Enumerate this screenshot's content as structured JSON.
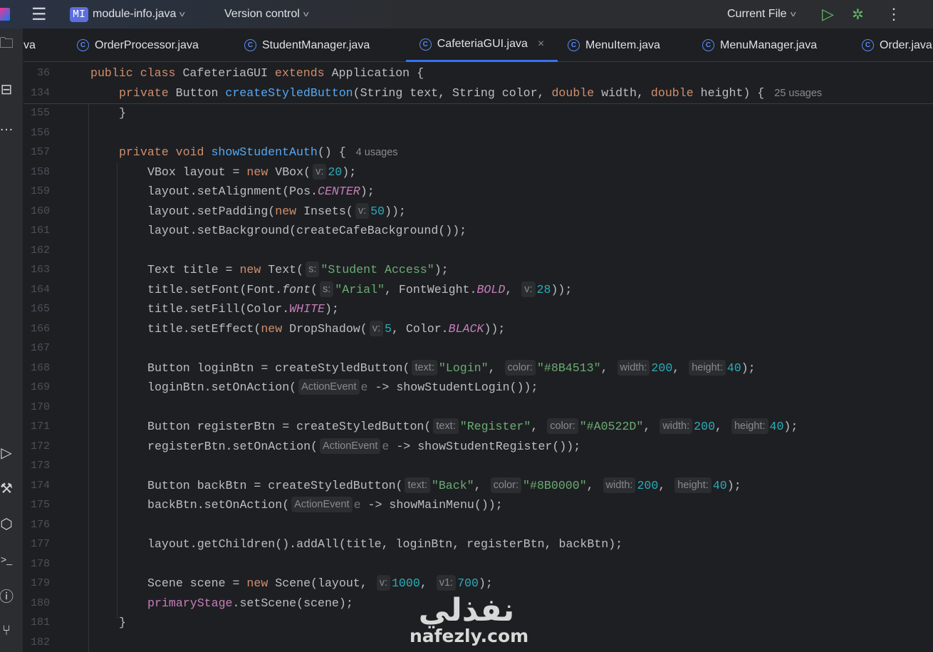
{
  "topbar": {
    "project_badge": "MI",
    "project_name": "module-info.java",
    "vcs": "Version control",
    "run_config": "Current File"
  },
  "tabs": [
    {
      "label": "va",
      "icon": false
    },
    {
      "label": "OrderProcessor.java",
      "icon": true
    },
    {
      "label": "StudentManager.java",
      "icon": true
    },
    {
      "label": "CafeteriaGUI.java",
      "icon": true,
      "active": true
    },
    {
      "label": "MenuItem.java",
      "icon": true
    },
    {
      "label": "MenuManager.java",
      "icon": true
    },
    {
      "label": "Order.java",
      "icon": true
    }
  ],
  "colors": {
    "keyword": "#cf8e6d",
    "function": "#56a8f5",
    "string": "#6aab73",
    "number": "#2aacb8",
    "constant": "#c77dbb",
    "accent": "#3574f0"
  },
  "code": [
    {
      "n": "36",
      "indent": 0,
      "t": [
        [
          "kw",
          "public class "
        ],
        [
          "p",
          "CafeteriaGUI "
        ],
        [
          "kw",
          "extends "
        ],
        [
          "p",
          "Application {"
        ]
      ]
    },
    {
      "n": "134",
      "indent": 1,
      "t": [
        [
          "kw",
          "private "
        ],
        [
          "p",
          "Button "
        ],
        [
          "fn",
          "createStyledButton"
        ],
        [
          "p",
          "(String text, String color, "
        ],
        [
          "kw",
          "double "
        ],
        [
          "p",
          "width, "
        ],
        [
          "kw",
          "double "
        ],
        [
          "p",
          "height) {"
        ],
        [
          "u",
          "25 usages"
        ]
      ]
    },
    {
      "n": "155",
      "indent": 1,
      "t": [
        [
          "p",
          "}"
        ]
      ]
    },
    {
      "n": "156",
      "indent": 0,
      "t": []
    },
    {
      "n": "157",
      "indent": 1,
      "t": [
        [
          "kw",
          "private void "
        ],
        [
          "fn",
          "showStudentAuth"
        ],
        [
          "p",
          "() {"
        ],
        [
          "u",
          "4 usages"
        ]
      ]
    },
    {
      "n": "158",
      "indent": 2,
      "t": [
        [
          "p",
          "VBox layout = "
        ],
        [
          "kw",
          "new "
        ],
        [
          "p",
          "VBox("
        ],
        [
          "h",
          "v:"
        ],
        [
          "num",
          "20"
        ],
        [
          "p",
          ");"
        ]
      ]
    },
    {
      "n": "159",
      "indent": 2,
      "t": [
        [
          "p",
          "layout.setAlignment(Pos."
        ],
        [
          "c",
          "CENTER"
        ],
        [
          "p",
          ");"
        ]
      ]
    },
    {
      "n": "160",
      "indent": 2,
      "t": [
        [
          "p",
          "layout.setPadding("
        ],
        [
          "kw",
          "new "
        ],
        [
          "p",
          "Insets("
        ],
        [
          "h",
          "v:"
        ],
        [
          "num",
          "50"
        ],
        [
          "p",
          "));"
        ]
      ]
    },
    {
      "n": "161",
      "indent": 2,
      "t": [
        [
          "p",
          "layout.setBackground(createCafeBackground());"
        ]
      ]
    },
    {
      "n": "162",
      "indent": 0,
      "t": []
    },
    {
      "n": "163",
      "indent": 2,
      "t": [
        [
          "p",
          "Text title = "
        ],
        [
          "kw",
          "new "
        ],
        [
          "p",
          "Text("
        ],
        [
          "h",
          "s:"
        ],
        [
          "str",
          "\"Student Access\""
        ],
        [
          "p",
          ");"
        ]
      ]
    },
    {
      "n": "164",
      "indent": 2,
      "t": [
        [
          "p",
          "title.setFont(Font."
        ],
        [
          "i",
          "font"
        ],
        [
          "p",
          "("
        ],
        [
          "h",
          "s:"
        ],
        [
          "str",
          "\"Arial\""
        ],
        [
          "p",
          ", FontWeight."
        ],
        [
          "c",
          "BOLD"
        ],
        [
          "p",
          ", "
        ],
        [
          "h",
          "v:"
        ],
        [
          "num",
          "28"
        ],
        [
          "p",
          "));"
        ]
      ]
    },
    {
      "n": "165",
      "indent": 2,
      "t": [
        [
          "p",
          "title.setFill(Color."
        ],
        [
          "c",
          "WHITE"
        ],
        [
          "p",
          ");"
        ]
      ]
    },
    {
      "n": "166",
      "indent": 2,
      "t": [
        [
          "p",
          "title.setEffect("
        ],
        [
          "kw",
          "new "
        ],
        [
          "p",
          "DropShadow("
        ],
        [
          "h",
          "v:"
        ],
        [
          "num",
          "5"
        ],
        [
          "p",
          ", Color."
        ],
        [
          "c",
          "BLACK"
        ],
        [
          "p",
          "));"
        ]
      ]
    },
    {
      "n": "167",
      "indent": 0,
      "t": []
    },
    {
      "n": "168",
      "indent": 2,
      "t": [
        [
          "p",
          "Button loginBtn = createStyledButton("
        ],
        [
          "h",
          "text:"
        ],
        [
          "str",
          "\"Login\""
        ],
        [
          "p",
          ", "
        ],
        [
          "h",
          "color:"
        ],
        [
          "str",
          "\"#8B4513\""
        ],
        [
          "p",
          ", "
        ],
        [
          "h",
          "width:"
        ],
        [
          "num",
          "200"
        ],
        [
          "p",
          ", "
        ],
        [
          "h",
          "height:"
        ],
        [
          "num",
          "40"
        ],
        [
          "p",
          ");"
        ]
      ]
    },
    {
      "n": "169",
      "indent": 2,
      "t": [
        [
          "p",
          "loginBtn.setOnAction("
        ],
        [
          "h",
          "ActionEvent"
        ],
        [
          "g",
          "e"
        ],
        [
          "p",
          " -> showStudentLogin());"
        ]
      ]
    },
    {
      "n": "170",
      "indent": 0,
      "t": []
    },
    {
      "n": "171",
      "indent": 2,
      "t": [
        [
          "p",
          "Button registerBtn = createStyledButton("
        ],
        [
          "h",
          "text:"
        ],
        [
          "str",
          "\"Register\""
        ],
        [
          "p",
          ", "
        ],
        [
          "h",
          "color:"
        ],
        [
          "str",
          "\"#A0522D\""
        ],
        [
          "p",
          ", "
        ],
        [
          "h",
          "width:"
        ],
        [
          "num",
          "200"
        ],
        [
          "p",
          ", "
        ],
        [
          "h",
          "height:"
        ],
        [
          "num",
          "40"
        ],
        [
          "p",
          ");"
        ]
      ]
    },
    {
      "n": "172",
      "indent": 2,
      "t": [
        [
          "p",
          "registerBtn.setOnAction("
        ],
        [
          "h",
          "ActionEvent"
        ],
        [
          "g",
          "e"
        ],
        [
          "p",
          " -> showStudentRegister());"
        ]
      ]
    },
    {
      "n": "173",
      "indent": 0,
      "t": []
    },
    {
      "n": "174",
      "indent": 2,
      "t": [
        [
          "p",
          "Button backBtn = createStyledButton("
        ],
        [
          "h",
          "text:"
        ],
        [
          "str",
          "\"Back\""
        ],
        [
          "p",
          ", "
        ],
        [
          "h",
          "color:"
        ],
        [
          "str",
          "\"#8B0000\""
        ],
        [
          "p",
          ", "
        ],
        [
          "h",
          "width:"
        ],
        [
          "num",
          "200"
        ],
        [
          "p",
          ", "
        ],
        [
          "h",
          "height:"
        ],
        [
          "num",
          "40"
        ],
        [
          "p",
          ");"
        ]
      ]
    },
    {
      "n": "175",
      "indent": 2,
      "t": [
        [
          "p",
          "backBtn.setOnAction("
        ],
        [
          "h",
          "ActionEvent"
        ],
        [
          "g",
          "e"
        ],
        [
          "p",
          " -> showMainMenu());"
        ]
      ]
    },
    {
      "n": "176",
      "indent": 0,
      "t": []
    },
    {
      "n": "177",
      "indent": 2,
      "t": [
        [
          "p",
          "layout.getChildren().addAll(title, loginBtn, registerBtn, backBtn);"
        ]
      ]
    },
    {
      "n": "178",
      "indent": 0,
      "t": []
    },
    {
      "n": "179",
      "indent": 2,
      "t": [
        [
          "p",
          "Scene scene = "
        ],
        [
          "kw",
          "new "
        ],
        [
          "p",
          "Scene(layout, "
        ],
        [
          "h",
          "v:"
        ],
        [
          "num",
          "1000"
        ],
        [
          "p",
          ", "
        ],
        [
          "h",
          "v1:"
        ],
        [
          "num",
          "700"
        ],
        [
          "p",
          ");"
        ]
      ]
    },
    {
      "n": "180",
      "indent": 2,
      "t": [
        [
          "c2",
          "primaryStage"
        ],
        [
          "p",
          ".setScene(scene);"
        ]
      ]
    },
    {
      "n": "181",
      "indent": 1,
      "t": [
        [
          "p",
          "}"
        ]
      ]
    },
    {
      "n": "182",
      "indent": 0,
      "t": []
    }
  ],
  "watermark": {
    "arabic": "نفذلي",
    "latin": "nafezly.com"
  }
}
